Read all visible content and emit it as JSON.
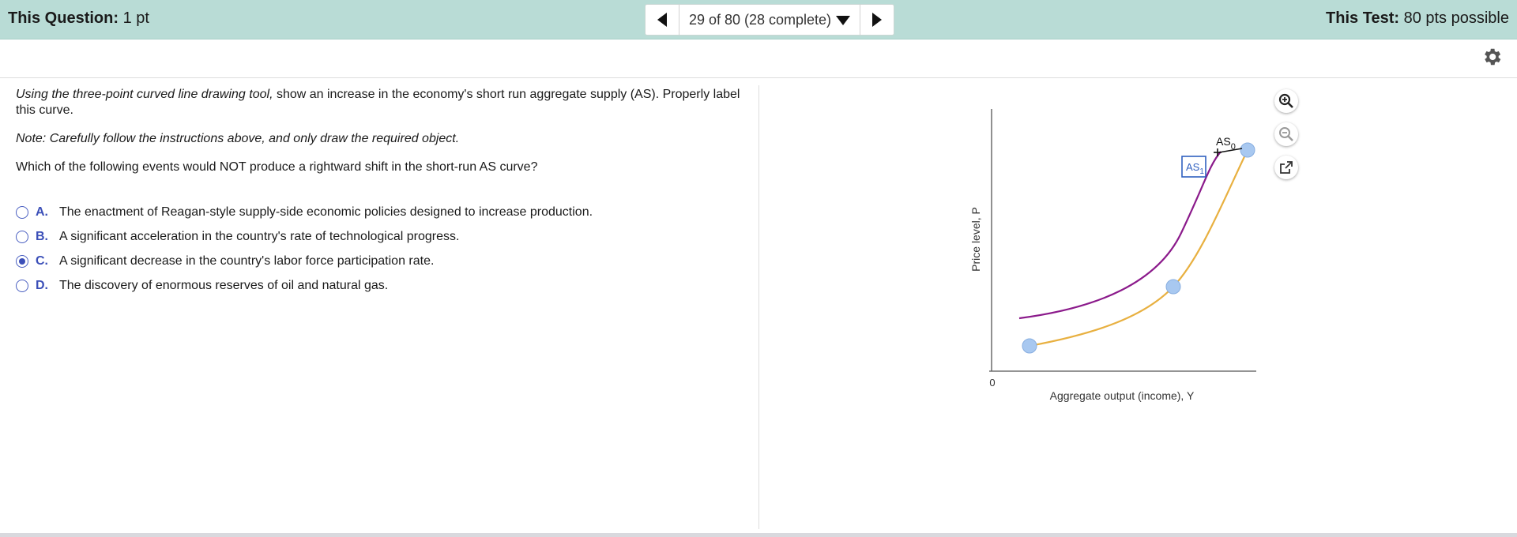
{
  "header": {
    "question_label": "This Question:",
    "question_points": "1 pt",
    "progress": "29 of 80 (28 complete)",
    "test_label": "This Test:",
    "test_points": "80 pts possible"
  },
  "question": {
    "instruction_italic": "Using the three-point curved line drawing tool,",
    "instruction_rest": " show an increase in the economy's short run aggregate supply (AS). Properly label this curve.",
    "note": "Note: Carefully follow the instructions above, and only draw the required object.",
    "prompt": "Which of the following events would NOT produce a rightward shift in the short-run AS curve?"
  },
  "choices": [
    {
      "letter": "A.",
      "text": "The enactment of Reagan-style supply-side economic policies designed to increase production.",
      "selected": false
    },
    {
      "letter": "B.",
      "text": "A significant acceleration in the country's rate of technological progress.",
      "selected": false
    },
    {
      "letter": "C.",
      "text": "A significant decrease in the country's labor force participation rate.",
      "selected": true
    },
    {
      "letter": "D.",
      "text": "The discovery of enormous reserves of oil and natural gas.",
      "selected": false
    }
  ],
  "graph": {
    "ylabel": "Price level, P",
    "xlabel": "Aggregate output (income), Y",
    "origin": "0",
    "as0_label": "AS",
    "as0_sub": "0",
    "as1_label": "AS",
    "as1_sub": "1",
    "colors": {
      "as0": "#e8b040",
      "as1": "#8b1a8b",
      "point": "#a8c8f0",
      "label_box": "#3060c0"
    }
  },
  "tools": [
    "zoom-in-icon",
    "zoom-out-icon",
    "popout-icon"
  ]
}
